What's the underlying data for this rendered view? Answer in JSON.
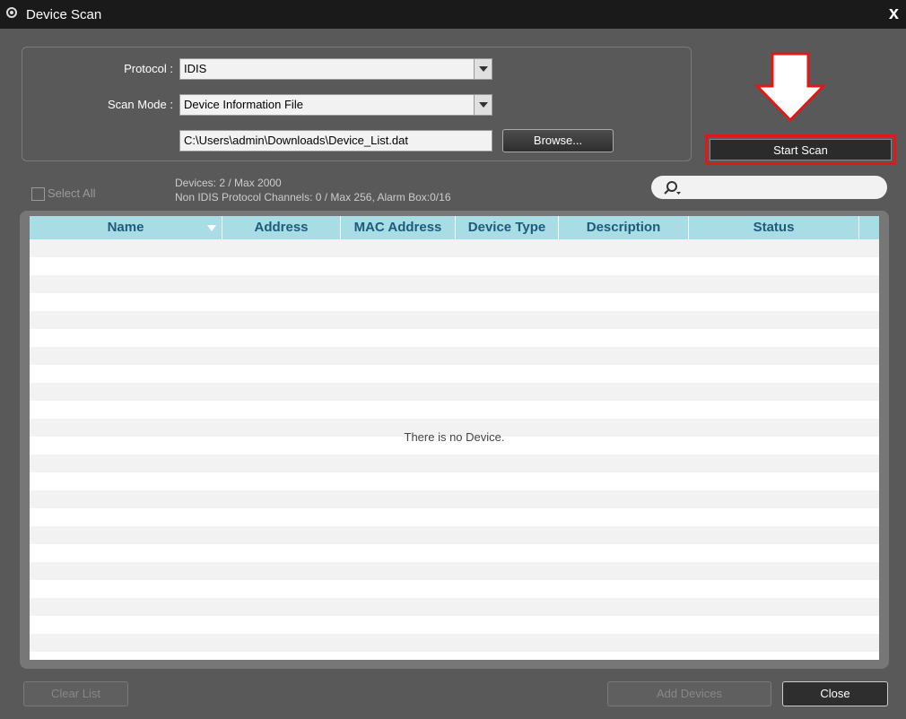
{
  "window": {
    "title": "Device Scan",
    "close_label": "x"
  },
  "form": {
    "protocol_label": "Protocol :",
    "protocol_value": "IDIS",
    "scan_mode_label": "Scan Mode :",
    "scan_mode_value": "Device Information File",
    "file_path": "C:\\Users\\admin\\Downloads\\Device_List.dat",
    "browse_label": "Browse..."
  },
  "actions": {
    "start_scan_label": "Start Scan"
  },
  "toolbar": {
    "select_all_label": "Select All",
    "devices_info": "Devices: 2 / Max 2000",
    "channels_info": "Non IDIS Protocol Channels: 0 / Max 256, Alarm Box:0/16",
    "search_placeholder": ""
  },
  "table": {
    "columns": [
      "Name",
      "Address",
      "MAC Address",
      "Device Type",
      "Description",
      "Status"
    ],
    "rows": [],
    "empty_message": "There is no Device."
  },
  "footer": {
    "clear_list_label": "Clear List",
    "add_devices_label": "Add Devices",
    "close_label": "Close"
  },
  "colors": {
    "highlight": "#e01818",
    "header_bg": "#a9dde5",
    "header_text": "#1e5a7a"
  }
}
